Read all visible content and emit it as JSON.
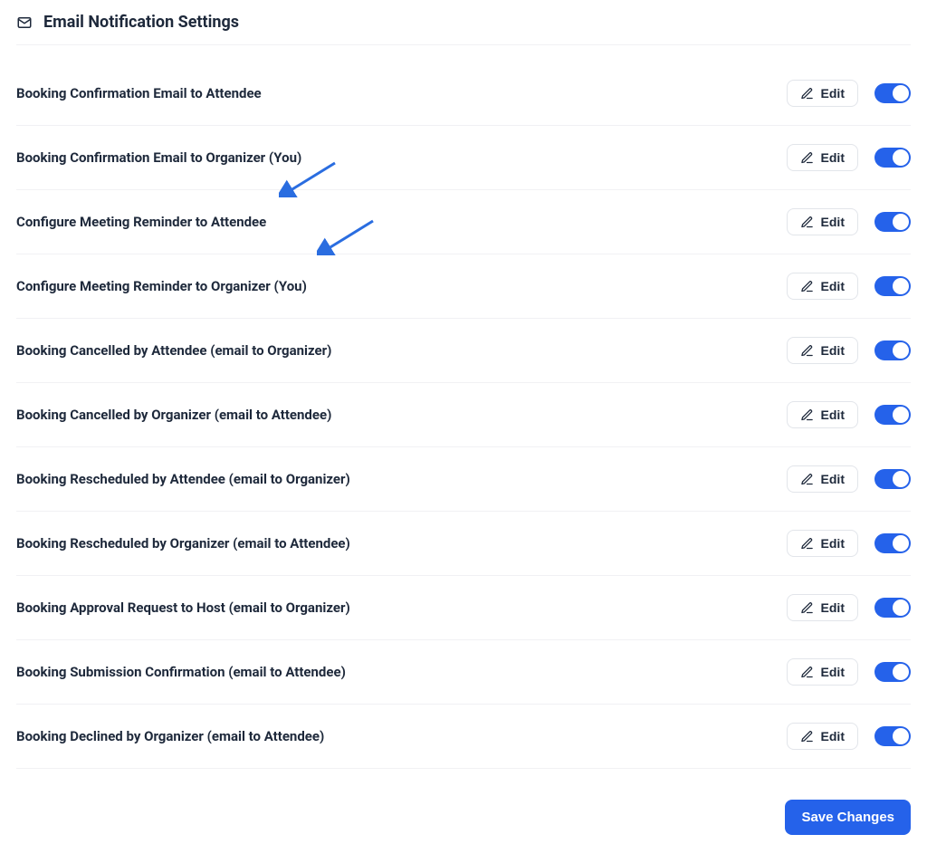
{
  "header": {
    "title": "Email Notification Settings"
  },
  "edit_label": "Edit",
  "rows": [
    {
      "label": "Booking Confirmation Email to Attendee"
    },
    {
      "label": "Booking Confirmation Email to Organizer (You)"
    },
    {
      "label": "Configure Meeting Reminder to Attendee"
    },
    {
      "label": "Configure Meeting Reminder to Organizer (You)"
    },
    {
      "label": "Booking Cancelled by Attendee (email to Organizer)"
    },
    {
      "label": "Booking Cancelled by Organizer (email to Attendee)"
    },
    {
      "label": "Booking Rescheduled by Attendee (email to Organizer)"
    },
    {
      "label": "Booking Rescheduled by Organizer (email to Attendee)"
    },
    {
      "label": "Booking Approval Request to Host (email to Organizer)"
    },
    {
      "label": "Booking Submission Confirmation (email to Attendee)"
    },
    {
      "label": "Booking Declined by Organizer (email to Attendee)"
    }
  ],
  "footer": {
    "save_label": "Save Changes"
  },
  "colors": {
    "accent": "#2562ea"
  }
}
